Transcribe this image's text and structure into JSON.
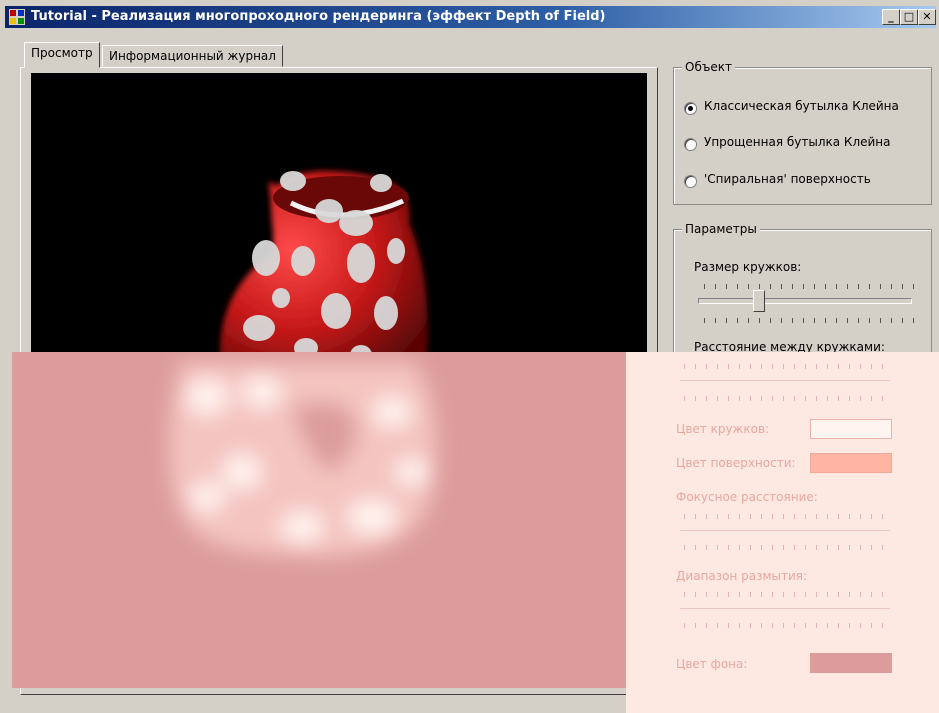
{
  "window": {
    "title": "Tutorial - Реализация многопроходного рендеринга (эффект Depth of Field)"
  },
  "caption_buttons": {
    "minimize": "_",
    "maximize": "□",
    "close": "✕"
  },
  "tabs": [
    {
      "label": "Просмотр",
      "active": true
    },
    {
      "label": "Информационный журнал",
      "active": false
    }
  ],
  "object_group": {
    "title": "Объект",
    "options": [
      {
        "label": "Классическая бутылка Клейна",
        "selected": true
      },
      {
        "label": "Упрощенная бутылка Клейна",
        "selected": false
      },
      {
        "label": "'Спиральная' поверхность",
        "selected": false
      }
    ]
  },
  "params_group": {
    "title": "Параметры",
    "dot_size_label": "Размер кружков:",
    "dot_size_value": 0.27,
    "dot_spacing_label": "Расстояние между кружками:",
    "dot_color_label": "Цвет кружков:",
    "surface_color_label": "Цвет поверхности:",
    "focal_distance_label": "Фокусное расстояние:",
    "blur_range_label": "Диапазон размытия:",
    "bg_color_label": "Цвет фона:"
  },
  "colors": {
    "surface": "#c41818",
    "dots": "#d8d8d8",
    "background": "#000000",
    "overlay": "#dc9c9c"
  }
}
